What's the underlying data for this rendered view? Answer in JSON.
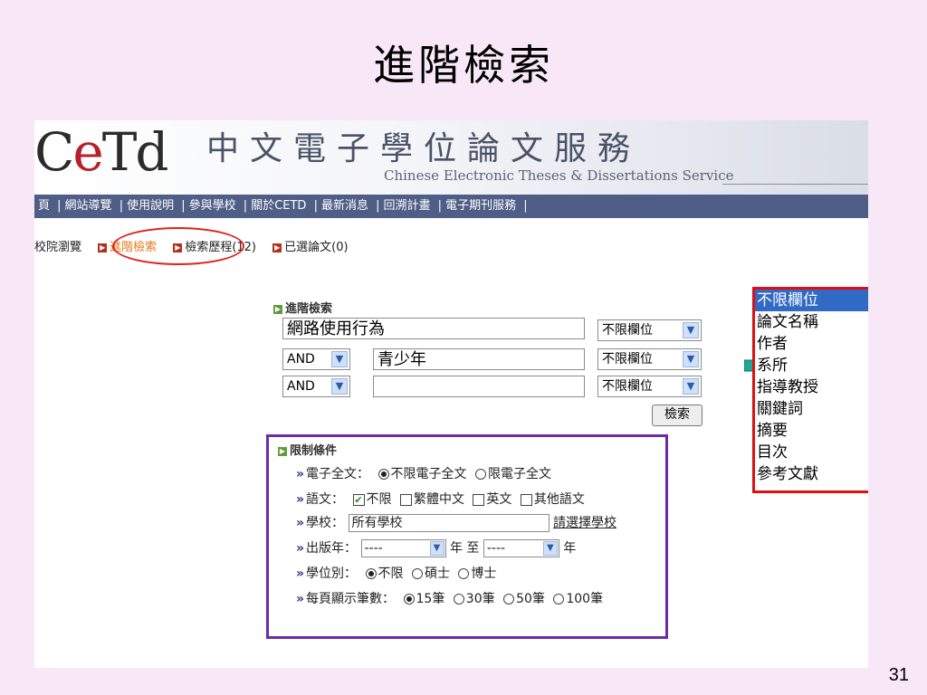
{
  "slide": {
    "title": "進階檢索",
    "page_number": "31"
  },
  "site": {
    "logo_e": "e",
    "logo_rest": "Td",
    "logo_lead": "C",
    "title": "中文電子學位論文服務",
    "subtitle": "Chinese Electronic Theses & Dissertations Service"
  },
  "nav": {
    "items": [
      "頁",
      "網站導覽",
      "使用說明",
      "參與學校",
      "關於CETD",
      "最新消息",
      "回溯計畫",
      "電子期刊服務"
    ]
  },
  "subnav": {
    "browse": "校院瀏覽",
    "advanced": "進階檢索",
    "history": "檢索歷程(12)",
    "selected": "已選論文(0)"
  },
  "search": {
    "heading": "進階檢索",
    "rows": [
      {
        "op": "",
        "value": "網路使用行為",
        "field": "不限欄位"
      },
      {
        "op": "AND",
        "value": "青少年",
        "field": "不限欄位"
      },
      {
        "op": "AND",
        "value": "",
        "field": "不限欄位"
      }
    ],
    "submit_label": "檢索"
  },
  "limits": {
    "heading": "限制條件",
    "fulltext": {
      "label": "電子全文：",
      "options": [
        "不限電子全文",
        "限電子全文"
      ],
      "selected": 0
    },
    "language": {
      "label": "語文：",
      "options": [
        "不限",
        "繁體中文",
        "英文",
        "其他語文"
      ],
      "checked": [
        true,
        false,
        false,
        false
      ]
    },
    "school": {
      "label": "學校：",
      "value": "所有學校",
      "link": "請選擇學校"
    },
    "year": {
      "label": "出版年：",
      "from": "----",
      "to_label": "年 至",
      "to": "----",
      "suffix": "年"
    },
    "degree": {
      "label": "學位別：",
      "options": [
        "不限",
        "碩士",
        "博士"
      ],
      "selected": 0
    },
    "per_page": {
      "label": "每頁顯示筆數：",
      "options": [
        "15筆",
        "30筆",
        "50筆",
        "100筆"
      ],
      "selected": 0
    }
  },
  "field_dropdown": {
    "options": [
      "不限欄位",
      "論文名稱",
      "作者",
      "系所",
      "指導教授",
      "關鍵詞",
      "摘要",
      "目次",
      "參考文獻"
    ],
    "selected": 0
  },
  "colors": {
    "background": "#f8e8f7",
    "navbar": "#4f5e86",
    "highlight_circle": "#e12020",
    "limits_border": "#6b2bab",
    "dropdown_border": "#e01010",
    "callout_arrow": "#1aa89a",
    "selected_option": "#316ac5"
  }
}
